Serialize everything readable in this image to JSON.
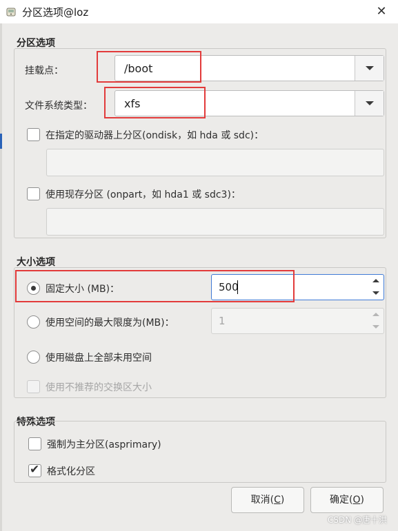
{
  "window": {
    "title": "分区选项@loz",
    "close_glyph": "✕"
  },
  "partition_options": {
    "heading": "分区选项",
    "mount_point": {
      "label": "挂载点：",
      "value": "/boot"
    },
    "fs_type": {
      "label": "文件系统类型：",
      "value": "xfs"
    },
    "ondisk": {
      "label": "在指定的驱动器上分区(ondisk，如 hda 或 sdc)：",
      "checked": false,
      "value": ""
    },
    "onpart": {
      "label": "使用现存分区 (onpart，如 hda1 或 sdc3)：",
      "checked": false,
      "value": ""
    }
  },
  "size_options": {
    "heading": "大小选项",
    "fixed": {
      "label": "固定大小 (MB)：",
      "selected": true,
      "value": "500"
    },
    "max": {
      "label": "使用空间的最大限度为(MB)：",
      "selected": false,
      "value": "1"
    },
    "fill": {
      "label": "使用磁盘上全部未用空间",
      "selected": false
    },
    "swap": {
      "label": "使用不推荐的交换区大小",
      "enabled": false
    }
  },
  "special_options": {
    "heading": "特殊选项",
    "asprimary": {
      "label": "强制为主分区(asprimary)",
      "checked": false
    },
    "format": {
      "label": "格式化分区",
      "checked": true
    }
  },
  "buttons": {
    "cancel": {
      "text": "取消(",
      "key": "C",
      "close": ")"
    },
    "ok": {
      "text": "确定(",
      "key": "O",
      "close": ")"
    }
  },
  "watermark": "CSDN @唐十洪",
  "colors": {
    "highlight": "#e23a3a",
    "focus": "#3f7ad6",
    "background": "#ecebe9"
  },
  "icons": {
    "app": "disk-app-icon",
    "close": "close-icon",
    "dropdown": "chevron-down-icon",
    "check": "checkmark-icon",
    "spin_up": "spin-up-icon",
    "spin_down": "spin-down-icon"
  }
}
